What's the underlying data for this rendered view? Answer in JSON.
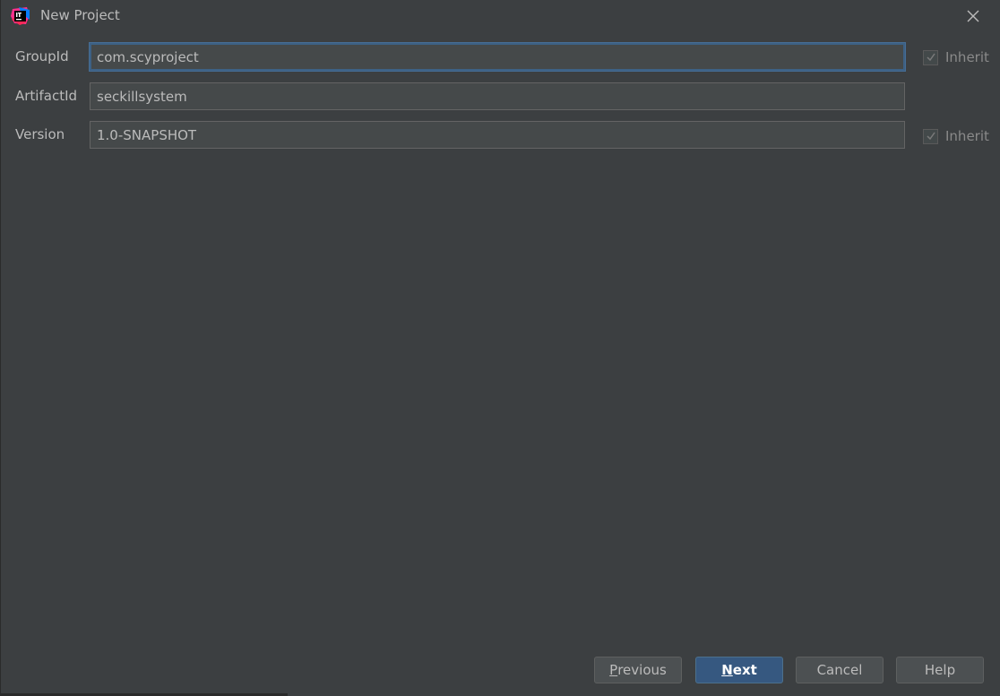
{
  "window": {
    "title": "New Project",
    "app_icon": "intellij-idea-icon",
    "close_icon": "close-icon"
  },
  "form": {
    "group_id": {
      "label": "GroupId",
      "value": "com.scyproject",
      "inherit_label": "Inherit",
      "inherit_checked": true
    },
    "artifact_id": {
      "label": "ArtifactId",
      "value": "seckillsystem"
    },
    "version": {
      "label": "Version",
      "value": "1.0-SNAPSHOT",
      "inherit_label": "Inherit",
      "inherit_checked": true
    }
  },
  "buttons": {
    "previous": {
      "first": "P",
      "rest": "revious"
    },
    "next": {
      "first": "N",
      "rest": "ext"
    },
    "cancel": "Cancel",
    "help": "Help"
  },
  "colors": {
    "background": "#3c3f41",
    "field_bg": "#45494a",
    "focus_border": "#3d6185",
    "primary_button": "#365880"
  }
}
